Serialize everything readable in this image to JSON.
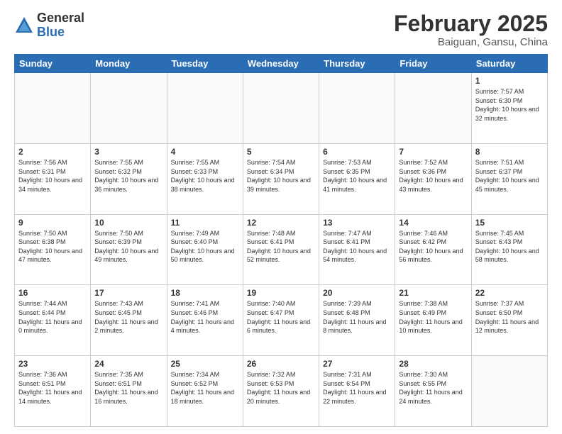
{
  "logo": {
    "general": "General",
    "blue": "Blue"
  },
  "header": {
    "title": "February 2025",
    "subtitle": "Baiguan, Gansu, China"
  },
  "weekdays": [
    "Sunday",
    "Monday",
    "Tuesday",
    "Wednesday",
    "Thursday",
    "Friday",
    "Saturday"
  ],
  "weeks": [
    [
      {
        "day": "",
        "info": ""
      },
      {
        "day": "",
        "info": ""
      },
      {
        "day": "",
        "info": ""
      },
      {
        "day": "",
        "info": ""
      },
      {
        "day": "",
        "info": ""
      },
      {
        "day": "",
        "info": ""
      },
      {
        "day": "1",
        "info": "Sunrise: 7:57 AM\nSunset: 6:30 PM\nDaylight: 10 hours\nand 32 minutes."
      }
    ],
    [
      {
        "day": "2",
        "info": "Sunrise: 7:56 AM\nSunset: 6:31 PM\nDaylight: 10 hours\nand 34 minutes."
      },
      {
        "day": "3",
        "info": "Sunrise: 7:55 AM\nSunset: 6:32 PM\nDaylight: 10 hours\nand 36 minutes."
      },
      {
        "day": "4",
        "info": "Sunrise: 7:55 AM\nSunset: 6:33 PM\nDaylight: 10 hours\nand 38 minutes."
      },
      {
        "day": "5",
        "info": "Sunrise: 7:54 AM\nSunset: 6:34 PM\nDaylight: 10 hours\nand 39 minutes."
      },
      {
        "day": "6",
        "info": "Sunrise: 7:53 AM\nSunset: 6:35 PM\nDaylight: 10 hours\nand 41 minutes."
      },
      {
        "day": "7",
        "info": "Sunrise: 7:52 AM\nSunset: 6:36 PM\nDaylight: 10 hours\nand 43 minutes."
      },
      {
        "day": "8",
        "info": "Sunrise: 7:51 AM\nSunset: 6:37 PM\nDaylight: 10 hours\nand 45 minutes."
      }
    ],
    [
      {
        "day": "9",
        "info": "Sunrise: 7:50 AM\nSunset: 6:38 PM\nDaylight: 10 hours\nand 47 minutes."
      },
      {
        "day": "10",
        "info": "Sunrise: 7:50 AM\nSunset: 6:39 PM\nDaylight: 10 hours\nand 49 minutes."
      },
      {
        "day": "11",
        "info": "Sunrise: 7:49 AM\nSunset: 6:40 PM\nDaylight: 10 hours\nand 50 minutes."
      },
      {
        "day": "12",
        "info": "Sunrise: 7:48 AM\nSunset: 6:41 PM\nDaylight: 10 hours\nand 52 minutes."
      },
      {
        "day": "13",
        "info": "Sunrise: 7:47 AM\nSunset: 6:41 PM\nDaylight: 10 hours\nand 54 minutes."
      },
      {
        "day": "14",
        "info": "Sunrise: 7:46 AM\nSunset: 6:42 PM\nDaylight: 10 hours\nand 56 minutes."
      },
      {
        "day": "15",
        "info": "Sunrise: 7:45 AM\nSunset: 6:43 PM\nDaylight: 10 hours\nand 58 minutes."
      }
    ],
    [
      {
        "day": "16",
        "info": "Sunrise: 7:44 AM\nSunset: 6:44 PM\nDaylight: 11 hours\nand 0 minutes."
      },
      {
        "day": "17",
        "info": "Sunrise: 7:43 AM\nSunset: 6:45 PM\nDaylight: 11 hours\nand 2 minutes."
      },
      {
        "day": "18",
        "info": "Sunrise: 7:41 AM\nSunset: 6:46 PM\nDaylight: 11 hours\nand 4 minutes."
      },
      {
        "day": "19",
        "info": "Sunrise: 7:40 AM\nSunset: 6:47 PM\nDaylight: 11 hours\nand 6 minutes."
      },
      {
        "day": "20",
        "info": "Sunrise: 7:39 AM\nSunset: 6:48 PM\nDaylight: 11 hours\nand 8 minutes."
      },
      {
        "day": "21",
        "info": "Sunrise: 7:38 AM\nSunset: 6:49 PM\nDaylight: 11 hours\nand 10 minutes."
      },
      {
        "day": "22",
        "info": "Sunrise: 7:37 AM\nSunset: 6:50 PM\nDaylight: 11 hours\nand 12 minutes."
      }
    ],
    [
      {
        "day": "23",
        "info": "Sunrise: 7:36 AM\nSunset: 6:51 PM\nDaylight: 11 hours\nand 14 minutes."
      },
      {
        "day": "24",
        "info": "Sunrise: 7:35 AM\nSunset: 6:51 PM\nDaylight: 11 hours\nand 16 minutes."
      },
      {
        "day": "25",
        "info": "Sunrise: 7:34 AM\nSunset: 6:52 PM\nDaylight: 11 hours\nand 18 minutes."
      },
      {
        "day": "26",
        "info": "Sunrise: 7:32 AM\nSunset: 6:53 PM\nDaylight: 11 hours\nand 20 minutes."
      },
      {
        "day": "27",
        "info": "Sunrise: 7:31 AM\nSunset: 6:54 PM\nDaylight: 11 hours\nand 22 minutes."
      },
      {
        "day": "28",
        "info": "Sunrise: 7:30 AM\nSunset: 6:55 PM\nDaylight: 11 hours\nand 24 minutes."
      },
      {
        "day": "",
        "info": ""
      }
    ]
  ]
}
